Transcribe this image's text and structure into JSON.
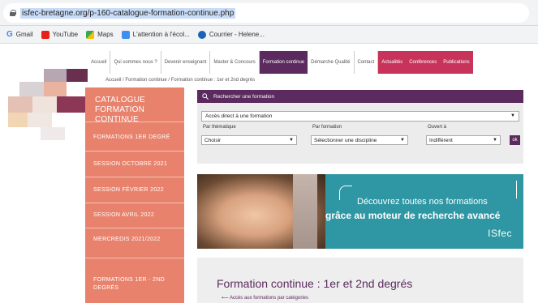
{
  "browser": {
    "url": "isfec-bretagne.org/p-160-catalogue-formation-continue.php",
    "bookmarks": [
      "Gmail",
      "YouTube",
      "Maps",
      "L'attention à l'écol...",
      "Courrier - Helene..."
    ]
  },
  "nav": {
    "items": [
      "Accueil",
      "Qui sommes nous ?",
      "Devenir enseignant",
      "Master & Concours",
      "Formation continue",
      "Démarche Qualité",
      "Contact",
      "Actualités",
      "Conférences",
      "Publications"
    ]
  },
  "breadcrumb": "Accueil  /  Formation continue  /  Formation continue : 1er et 2nd degrés",
  "sidebar": {
    "title_line1": "CATALOGUE",
    "title_line2": "FORMATION CONTINUE",
    "items": [
      "FORMATIONS 1ER DEGRÉ",
      "SESSION OCTOBRE 2021",
      "SESSION FÉVRIER 2022",
      "SESSION AVRIL 2022",
      "MERCREDIS 2021/2022",
      "FORMATIONS 1ER - 2ND",
      "DEGRÉS"
    ]
  },
  "search": {
    "header": "Rechercher une formation",
    "direct_value": "Accès direct à une formation",
    "labels": [
      "Par thématique",
      "Par formation",
      "Ouvert à"
    ],
    "values": [
      "Choisir",
      "Sélectionner une discipline",
      "Indifférent"
    ],
    "ok": "ok"
  },
  "banner": {
    "line1": "Découvrez toutes nos formations",
    "line2": "grâce au moteur de recherche avancé",
    "brand": "ISfec"
  },
  "content": {
    "title": "Formation continue : 1er et 2nd degrés",
    "link": "Accès aux formations par catégories"
  },
  "colors": {
    "accent_purple": "#5b2a5e",
    "salmon": "#e8826c",
    "teal": "#2f96a3",
    "red": "#c8335b"
  }
}
